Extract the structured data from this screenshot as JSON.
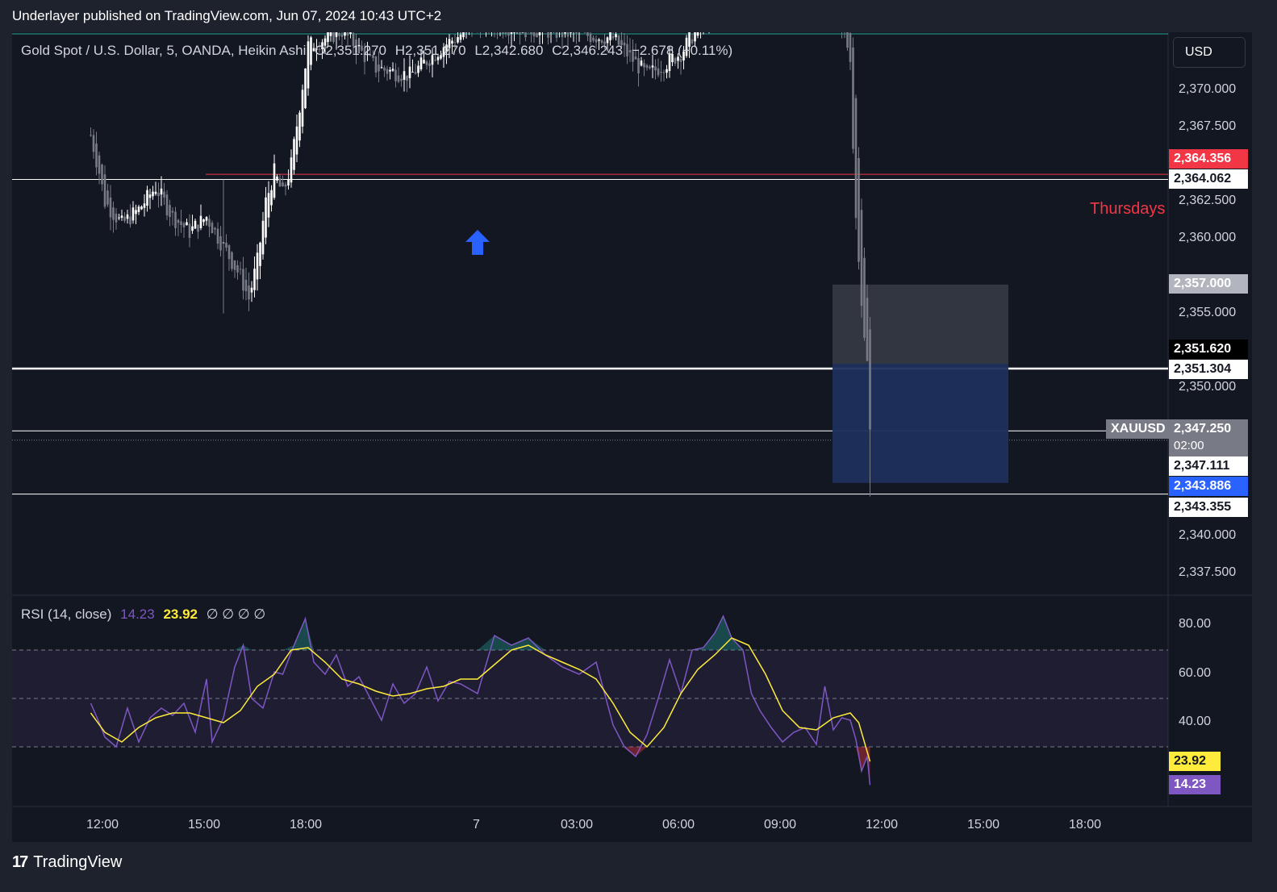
{
  "header": {
    "text": "Underlayer published on TradingView.com, Jun 07, 2024 10:43 UTC+2"
  },
  "legend": {
    "symbol": "Gold Spot / U.S. Dollar, 5, OANDA, Heikin Ashi",
    "open": "O2,351.270",
    "high": "H2,351.270",
    "low": "L2,342.680",
    "close": "C2,346.243",
    "change": "−2.678 (−0.11%)"
  },
  "currency_button": {
    "label": "USD"
  },
  "annotation_text": "Thursdays",
  "rsi_legend": {
    "label": "RSI (14, close)",
    "rsi_value": "14.23",
    "ma_value": "23.92",
    "nulls": "∅ ∅ ∅ ∅"
  },
  "price_ticks": [
    "2,370.000",
    "2,367.500",
    "2,362.500",
    "2,360.000",
    "2,355.000",
    "2,350.000",
    "2,340.000",
    "2,337.500"
  ],
  "rsi_ticks": [
    "80.00",
    "60.00",
    "40.00"
  ],
  "time_ticks": [
    "12:00",
    "15:00",
    "18:00",
    "7",
    "03:00",
    "06:00",
    "09:00",
    "12:00",
    "15:00",
    "18:00"
  ],
  "price_badges": {
    "red": "2,364.356",
    "line1": "2,364.062",
    "stop": "2,357.000",
    "entry_black": "2,351.620",
    "line2": "2,351.304",
    "symbol": "XAUUSD",
    "current": "2,347.250",
    "countdown": "02:00",
    "line3": "2,347.111",
    "target": "2,343.886",
    "line4": "2,343.355"
  },
  "rsi_badges": {
    "ma": "23.92",
    "rsi": "14.23"
  },
  "footer": {
    "brand": "TradingView"
  },
  "colors": {
    "background": "#131722",
    "bull_candle": "#ffffff",
    "bear_candle": "#787b86",
    "red_line": "#f23645",
    "position_stop": "#363a45",
    "position_target": "#1e2f5c",
    "rsi_line": "#7e57c2",
    "rsi_ma": "#ffeb3b",
    "arrow": "#2962ff"
  },
  "chart_data": [
    {
      "type": "candlestick",
      "title": "Gold Spot / U.S. Dollar, 5, OANDA, Heikin Ashi",
      "x_ticks": [
        "12:00",
        "15:00",
        "18:00",
        "7",
        "03:00",
        "06:00",
        "09:00",
        "12:00",
        "15:00",
        "18:00"
      ],
      "ylim": [
        2336,
        2372.5
      ],
      "price_path": [
        [
          "11:35",
          2367.0
        ],
        [
          "11:50",
          2364.5
        ],
        [
          "12:00",
          2362.5
        ],
        [
          "12:30",
          2361.0
        ],
        [
          "13:00",
          2362.0
        ],
        [
          "13:30",
          2363.5
        ],
        [
          "14:00",
          2361.5
        ],
        [
          "14:30",
          2360.5
        ],
        [
          "15:00",
          2361.5
        ],
        [
          "15:30",
          2359.5
        ],
        [
          "16:00",
          2357.5
        ],
        [
          "16:15",
          2356.0
        ],
        [
          "16:30",
          2358.5
        ],
        [
          "16:45",
          2362.5
        ],
        [
          "17:00",
          2364.5
        ],
        [
          "17:15",
          2363.0
        ],
        [
          "17:30",
          2365.0
        ],
        [
          "17:45",
          2369.0
        ],
        [
          "18:00",
          2373.0
        ],
        [
          "19:00",
          2374.0
        ],
        [
          "20:00",
          2371.5
        ],
        [
          "21:00",
          2371.0
        ],
        [
          "22:00",
          2373.0
        ],
        [
          "23:00",
          2374.5
        ],
        [
          "03:00",
          2373.5
        ],
        [
          "04:00",
          2371.0
        ],
        [
          "05:00",
          2372.5
        ],
        [
          "06:00",
          2376.0
        ],
        [
          "08:00",
          2377.0
        ],
        [
          "09:30",
          2377.5
        ],
        [
          "10:00",
          2372.0
        ],
        [
          "10:05",
          2366.5
        ],
        [
          "10:10",
          2362.0
        ],
        [
          "10:15",
          2358.5
        ],
        [
          "10:20",
          2355.0
        ],
        [
          "10:25",
          2353.0
        ],
        [
          "10:30",
          2351.8
        ],
        [
          "10:35",
          2347.25
        ]
      ],
      "horizontal_lines": [
        2364.356,
        2364.062,
        2351.304,
        2347.111,
        2343.355
      ],
      "long_position": {
        "stop": 2357.0,
        "entry": 2351.62,
        "target": 2343.886
      },
      "current_price": 2347.25,
      "annotations": [
        "Thursdays"
      ]
    },
    {
      "type": "line",
      "title": "RSI (14, close)",
      "ylim": [
        10,
        90
      ],
      "bands": {
        "upper": 70,
        "middle": 50,
        "lower": 30
      },
      "series": [
        {
          "name": "RSI",
          "points": [
            [
              "11:35",
              48
            ],
            [
              "11:50",
              40
            ],
            [
              "12:00",
              34
            ],
            [
              "12:20",
              30
            ],
            [
              "12:40",
              46
            ],
            [
              "13:00",
              32
            ],
            [
              "13:20",
              42
            ],
            [
              "13:40",
              46
            ],
            [
              "14:00",
              43
            ],
            [
              "14:20",
              48
            ],
            [
              "14:40",
              36
            ],
            [
              "15:00",
              58
            ],
            [
              "15:10",
              32
            ],
            [
              "15:30",
              42
            ],
            [
              "15:50",
              63
            ],
            [
              "16:05",
              72
            ],
            [
              "16:20",
              50
            ],
            [
              "16:40",
              46
            ],
            [
              "17:00",
              61
            ],
            [
              "17:15",
              60
            ],
            [
              "17:35",
              72
            ],
            [
              "17:55",
              83
            ],
            [
              "18:10",
              65
            ],
            [
              "18:30",
              60
            ],
            [
              "18:50",
              68
            ],
            [
              "19:10",
              55
            ],
            [
              "19:30",
              59
            ],
            [
              "19:50",
              50
            ],
            [
              "20:10",
              41
            ],
            [
              "20:30",
              56
            ],
            [
              "20:50",
              48
            ],
            [
              "21:10",
              52
            ],
            [
              "21:30",
              63
            ],
            [
              "21:50",
              49
            ],
            [
              "22:10",
              57
            ],
            [
              "22:30",
              56
            ],
            [
              "23:00",
              52
            ],
            [
              "23:30",
              76
            ],
            [
              "00:00",
              72
            ],
            [
              "00:30",
              75
            ],
            [
              "01:00",
              68
            ],
            [
              "01:30",
              63
            ],
            [
              "02:00",
              60
            ],
            [
              "02:30",
              65
            ],
            [
              "03:00",
              39
            ],
            [
              "03:20",
              30
            ],
            [
              "03:40",
              26
            ],
            [
              "04:00",
              35
            ],
            [
              "04:20",
              50
            ],
            [
              "04:40",
              66
            ],
            [
              "05:00",
              52
            ],
            [
              "05:20",
              70
            ],
            [
              "05:40",
              71
            ],
            [
              "06:00",
              77
            ],
            [
              "06:15",
              84
            ],
            [
              "06:30",
              75
            ],
            [
              "06:50",
              70
            ],
            [
              "07:05",
              52
            ],
            [
              "07:20",
              45
            ],
            [
              "07:40",
              38
            ],
            [
              "08:00",
              32
            ],
            [
              "08:20",
              36
            ],
            [
              "08:40",
              38
            ],
            [
              "09:00",
              31
            ],
            [
              "09:15",
              55
            ],
            [
              "09:30",
              37
            ],
            [
              "09:45",
              42
            ],
            [
              "10:00",
              41
            ],
            [
              "10:10",
              33
            ],
            [
              "10:20",
              20
            ],
            [
              "10:30",
              26
            ],
            [
              "10:35",
              14.23
            ]
          ]
        },
        {
          "name": "RSI-based MA",
          "points": [
            [
              "11:35",
              44
            ],
            [
              "12:00",
              36
            ],
            [
              "12:30",
              32
            ],
            [
              "13:00",
              38
            ],
            [
              "13:30",
              42
            ],
            [
              "14:00",
              44
            ],
            [
              "14:30",
              44
            ],
            [
              "15:00",
              42
            ],
            [
              "15:30",
              40
            ],
            [
              "16:00",
              45
            ],
            [
              "16:30",
              55
            ],
            [
              "17:00",
              60
            ],
            [
              "17:30",
              70
            ],
            [
              "18:00",
              71
            ],
            [
              "18:30",
              65
            ],
            [
              "19:00",
              58
            ],
            [
              "19:30",
              56
            ],
            [
              "20:00",
              53
            ],
            [
              "20:30",
              51
            ],
            [
              "21:00",
              52
            ],
            [
              "21:30",
              54
            ],
            [
              "22:00",
              55
            ],
            [
              "22:30",
              58
            ],
            [
              "23:00",
              58
            ],
            [
              "23:30",
              64
            ],
            [
              "00:00",
              70
            ],
            [
              "00:30",
              72
            ],
            [
              "01:00",
              68
            ],
            [
              "01:30",
              65
            ],
            [
              "02:00",
              62
            ],
            [
              "02:30",
              58
            ],
            [
              "03:00",
              48
            ],
            [
              "03:30",
              36
            ],
            [
              "04:00",
              30
            ],
            [
              "04:30",
              38
            ],
            [
              "05:00",
              52
            ],
            [
              "05:30",
              62
            ],
            [
              "06:00",
              68
            ],
            [
              "06:30",
              75
            ],
            [
              "07:00",
              72
            ],
            [
              "07:30",
              60
            ],
            [
              "08:00",
              45
            ],
            [
              "08:30",
              38
            ],
            [
              "09:00",
              37
            ],
            [
              "09:30",
              42
            ],
            [
              "10:00",
              44
            ],
            [
              "10:15",
              40
            ],
            [
              "10:35",
              23.92
            ]
          ]
        }
      ]
    }
  ]
}
